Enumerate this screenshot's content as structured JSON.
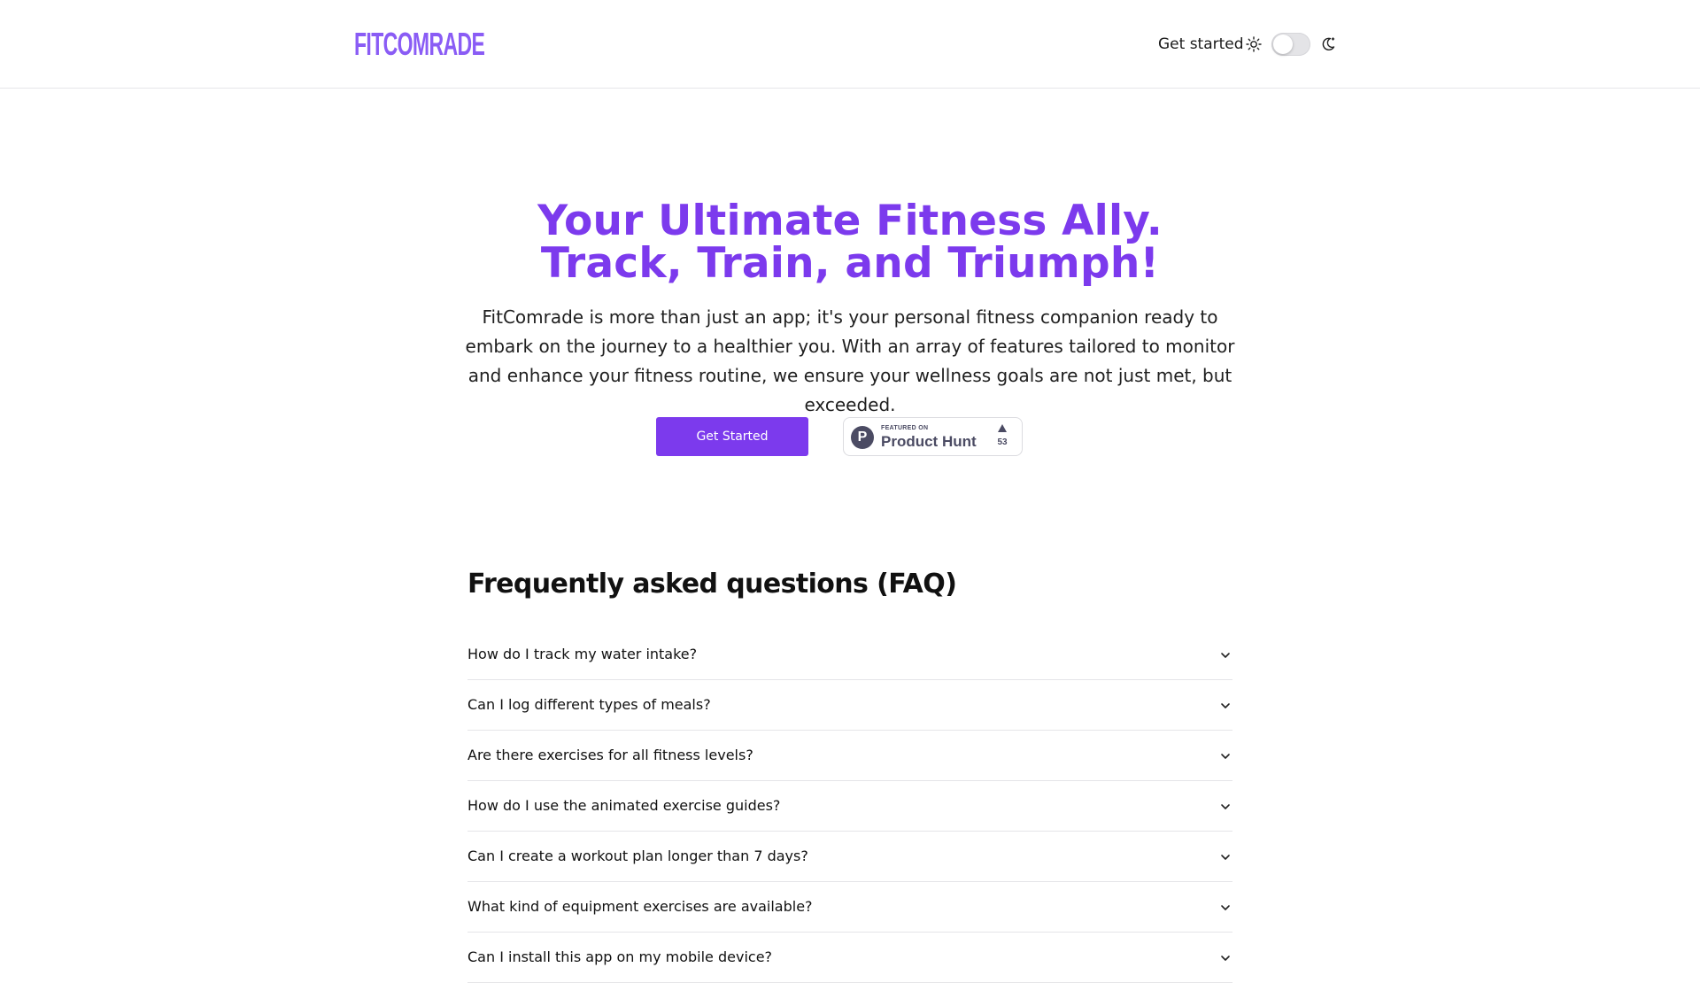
{
  "header": {
    "logo_text": "FITCOMRADE",
    "nav_link": "Get started",
    "theme_toggle": {
      "state": "light",
      "icons": [
        "sun-icon",
        "moon-icon"
      ]
    }
  },
  "hero": {
    "title_line1": "Your Ultimate Fitness Ally.",
    "title_line2": "Track, Train, and Triumph!",
    "description": "FitComrade is more than just an app; it's your personal fitness companion ready to embark on the journey to a healthier you. With an array of features tailored to monitor and enhance your fitness routine, we ensure your wellness goals are not just met, but exceeded.",
    "cta_label": "Get Started",
    "product_hunt": {
      "logo_letter": "P",
      "featured_text": "FEATURED ON",
      "name": "Product Hunt",
      "upvotes": "53"
    }
  },
  "faq": {
    "title": "Frequently asked questions (FAQ)",
    "items": [
      {
        "question": "How do I track my water intake?"
      },
      {
        "question": "Can I log different types of meals?"
      },
      {
        "question": "Are there exercises for all fitness levels?"
      },
      {
        "question": "How do I use the animated exercise guides?"
      },
      {
        "question": "Can I create a workout plan longer than 7 days?"
      },
      {
        "question": "What kind of equipment exercises are available?"
      },
      {
        "question": "Can I install this app on my mobile device?"
      }
    ]
  },
  "colors": {
    "brand_purple": "#7c3aed",
    "logo_purple": "#8a5cf5",
    "text": "#111111",
    "divider": "#e5e5e8"
  }
}
